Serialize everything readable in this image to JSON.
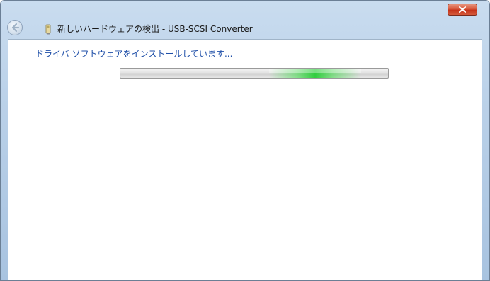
{
  "window": {
    "title": "新しいハードウェアの検出 - USB-SCSI Converter"
  },
  "titlebar": {
    "back_icon": "back-arrow-icon",
    "device_icon": "usb-device-icon",
    "close_icon": "close-x-icon"
  },
  "content": {
    "status_text": "ドライバ ソフトウェアをインストールしています..."
  },
  "progress": {
    "mode": "indeterminate",
    "accent_color": "#2fd044"
  },
  "colors": {
    "status_text": "#1f4fa8",
    "close_button": "#c5331a"
  }
}
